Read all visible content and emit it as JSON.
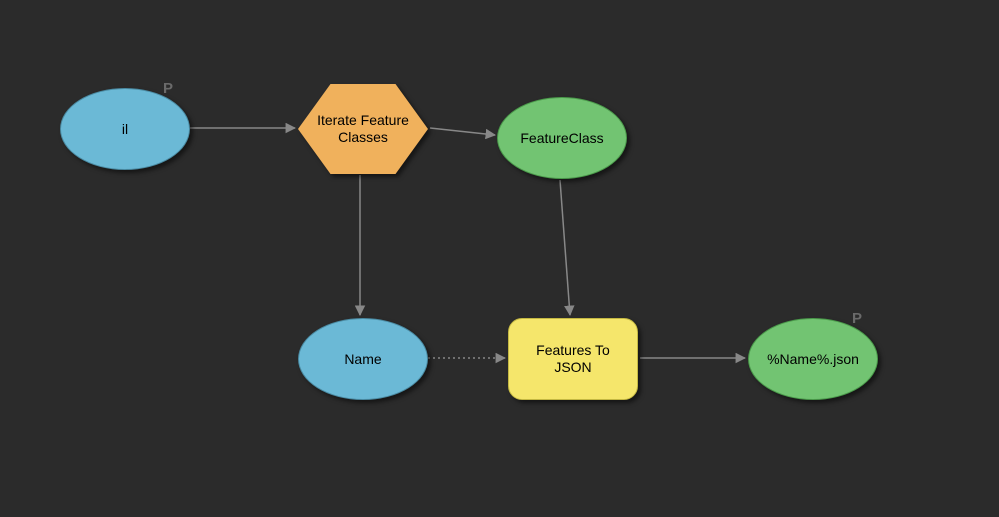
{
  "diagram": {
    "nodes": {
      "input": {
        "label": "il",
        "parameter_badge": "P"
      },
      "iterator": {
        "label": "Iterate Feature\nClasses"
      },
      "output_feature": {
        "label": "FeatureClass"
      },
      "output_name": {
        "label": "Name"
      },
      "tool": {
        "label": "Features To\nJSON"
      },
      "result": {
        "label": "%Name%.json",
        "parameter_badge": "P"
      }
    },
    "colors": {
      "background": "#2b2b2b",
      "input_variable": "#6bb9d6",
      "data_variable": "#72c472",
      "iterator": "#f0b15c",
      "tool": "#f5e66b"
    }
  }
}
